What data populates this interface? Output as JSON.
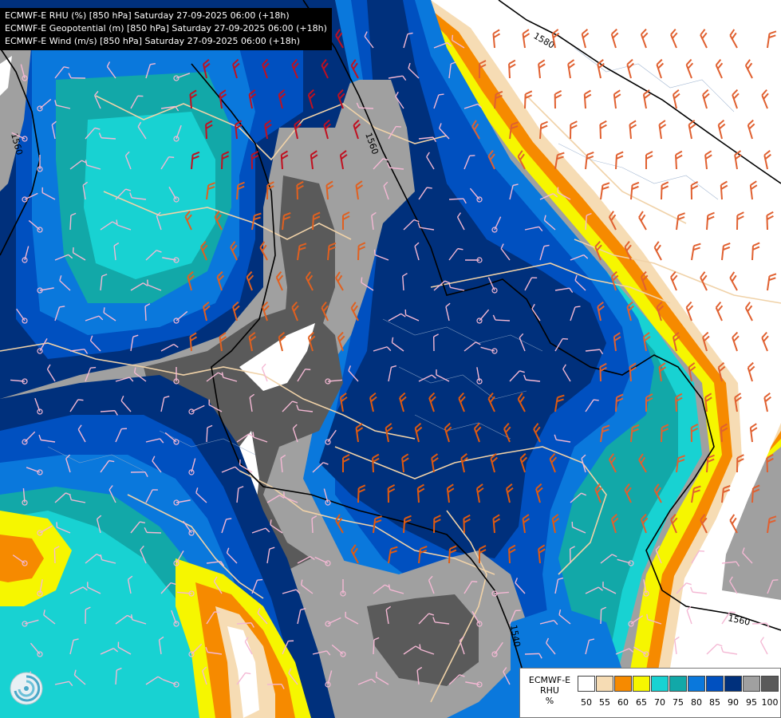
{
  "header": {
    "line1": "ECMWF-E RHU (%) [850 hPa] Saturday 27-09-2025 06:00 (+18h)",
    "line2": "ECMWF-E Geopotential (m) [850 hPa] Saturday 27-09-2025 06:00 (+18h)",
    "line3": "ECMWF-E Wind (m/s) [850 hPa] Saturday 27-09-2025 06:00 (+18h)"
  },
  "contours": {
    "labels": [
      "1580",
      "1560",
      "1560",
      "1560",
      "1540"
    ]
  },
  "legend": {
    "model": "ECMWF-E",
    "variable": "RHU",
    "unit": "%",
    "ticks": [
      "50",
      "55",
      "60",
      "65",
      "70",
      "75",
      "80",
      "85",
      "90",
      "95",
      "100"
    ],
    "colors": [
      "#ffffff",
      "#f6dcb4",
      "#f68a00",
      "#f6f600",
      "#18d2d2",
      "#12a8a8",
      "#0a78dc",
      "#0050c0",
      "#00307c",
      "#a0a0a0",
      "#5a5a5a"
    ]
  },
  "palette": {
    "white": "#ffffff",
    "tan": "#f6dcb4",
    "orange": "#f68a00",
    "yellow": "#f6f600",
    "cyan": "#18d2d2",
    "teal": "#12a8a8",
    "blue": "#0a78dc",
    "midblue": "#0050c0",
    "navy": "#00307c",
    "grey": "#a0a0a0",
    "darkgrey": "#5a5a5a"
  },
  "icons": {
    "logo": "ecmwf-logo-icon"
  }
}
